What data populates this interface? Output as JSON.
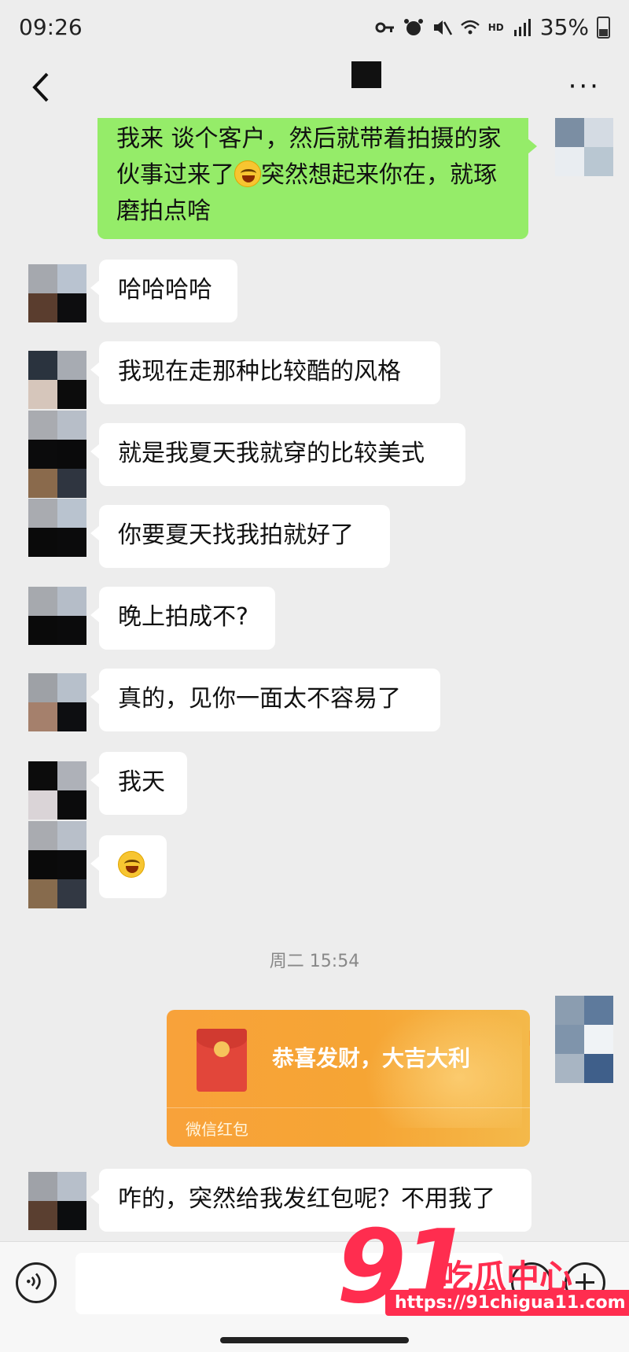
{
  "status_bar": {
    "time": "09:26",
    "network_badge": "HD",
    "battery": "35%"
  },
  "nav": {
    "back_icon": "chevron-left-icon",
    "more_icon": "more-icon",
    "more_label": "···"
  },
  "messages": [
    {
      "sender": "me",
      "text": "我来  谈个客户，然后就带着拍摄的家伙事过来了",
      "emoji": "laugh-cry-emoji",
      "text2": "突然想起来你在，就琢磨拍点啥"
    },
    {
      "sender": "other",
      "text": "哈哈哈哈"
    },
    {
      "sender": "other",
      "text": "我现在走那种比较酷的风格"
    },
    {
      "sender": "other",
      "text": "就是我夏天我就穿的比较美式"
    },
    {
      "sender": "other",
      "text": "你要夏天找我拍就好了"
    },
    {
      "sender": "other",
      "text": "晚上拍成不?"
    },
    {
      "sender": "other",
      "text": "真的，见你一面太不容易了"
    },
    {
      "sender": "other",
      "text": "我天"
    },
    {
      "sender": "other",
      "text": "",
      "emoji": "laugh-cry-emoji"
    },
    {
      "sender": "other",
      "text": "咋的，突然给我发红包呢？不用我了"
    }
  ],
  "timestamp": "周二 15:54",
  "red_packet": {
    "message": "恭喜发财，大吉大利",
    "label": "微信红包"
  },
  "input_bar": {
    "voice_icon": "voice-icon",
    "emoji_icon": "emoji-icon",
    "plus_icon": "plus-icon"
  },
  "watermark": {
    "number": "91",
    "name": "吃瓜中心",
    "url": "https://91chigua11.com"
  },
  "colors": {
    "background": "#ededed",
    "outgoing_bubble": "#95ec69",
    "incoming_bubble": "#ffffff",
    "red_packet": "#f6a534",
    "watermark": "#ff2d4f"
  }
}
